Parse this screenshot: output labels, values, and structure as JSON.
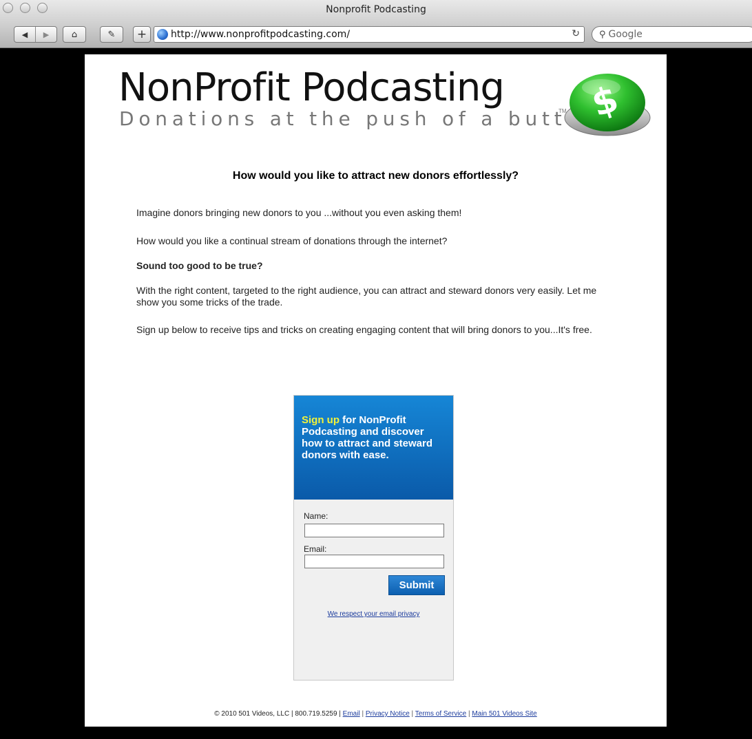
{
  "browser": {
    "window_title": "Nonprofit Podcasting",
    "url": "http://www.nonprofitpodcasting.com/",
    "search_placeholder": "Google"
  },
  "logo": {
    "title": "NonProfit Podcasting",
    "tagline": "Donations at the push of a button",
    "tm": "TM",
    "button_symbol": "$",
    "button_color": "#2fbf2f"
  },
  "content": {
    "headline": "How would you like to attract new donors effortlessly?",
    "p1": "Imagine donors bringing new donors to you ...without you even asking them!",
    "p2": "How would you like a continual stream of donations through the internet?",
    "p3_bold": "Sound too good to be true?",
    "p4": "With the right content, targeted to the right audience, you can attract and steward donors very easily. Let me show you some tricks of the trade.",
    "p5": "Sign up below to receive tips and tricks on creating engaging content that will bring donors to you...It's free."
  },
  "signup": {
    "highlight": "Sign up",
    "text": " for NonProfit Podcasting and discover how to attract and steward donors with ease.",
    "name_label": "Name:",
    "email_label": "Email:",
    "submit_label": "Submit",
    "privacy_link": "We respect your email privacy"
  },
  "footer": {
    "copyright": "© 2010 501 Videos, LLC | 800.719.5259 |",
    "links": [
      "Email",
      "Privacy Notice",
      "Terms of Service",
      "Main 501 Videos Site"
    ],
    "separator": "|"
  }
}
